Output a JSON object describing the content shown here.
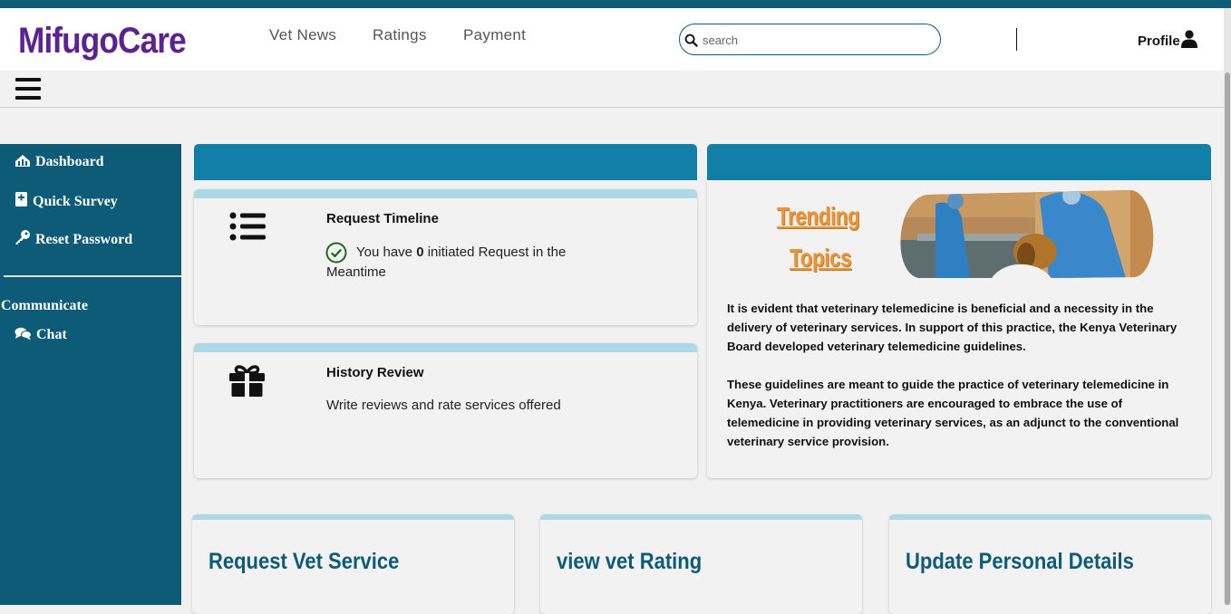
{
  "brand": "MifugoCare",
  "nav": {
    "links": [
      "Vet News",
      "Ratings",
      "Payment"
    ],
    "search_placeholder": "search",
    "profile_label": "Profile"
  },
  "sidebar": {
    "items": [
      {
        "label": "Dashboard",
        "icon": "dashboard-icon"
      },
      {
        "label": "Quick Survey",
        "icon": "survey-icon"
      },
      {
        "label": "Reset Password",
        "icon": "key-icon"
      }
    ],
    "section_heading": "Communicate",
    "chat_label": "Chat"
  },
  "request_timeline": {
    "title": "Request Timeline",
    "text_before": "You have",
    "count": "0",
    "text_after": "initiated Request in the",
    "text_line2": "Meantime"
  },
  "history_review": {
    "title": "History Review",
    "text": "Write reviews and rate services offered"
  },
  "trending": {
    "line1": "Trending",
    "line2": "Topics",
    "paragraph1": "It is evident that veterinary telemedicine is beneficial and a necessity in the delivery of veterinary services. In support of this practice, the Kenya Veterinary Board developed veterinary telemedicine guidelines.",
    "paragraph2": "These guidelines are meant to guide the practice of veterinary telemedicine in Kenya. Veterinary practitioners are encouraged to embrace the use of telemedicine in providing veterinary services, as an adjunct to the conventional veterinary service provision."
  },
  "action_cards": [
    {
      "title": "Request Vet Service"
    },
    {
      "title": "view vet Rating"
    },
    {
      "title": "Update Personal Details"
    }
  ],
  "colors": {
    "brand": "#5b2391",
    "primary": "#0d5b76",
    "header_bar": "#127fa7",
    "card_accent": "#add8e6",
    "trending": "#e8953a"
  }
}
